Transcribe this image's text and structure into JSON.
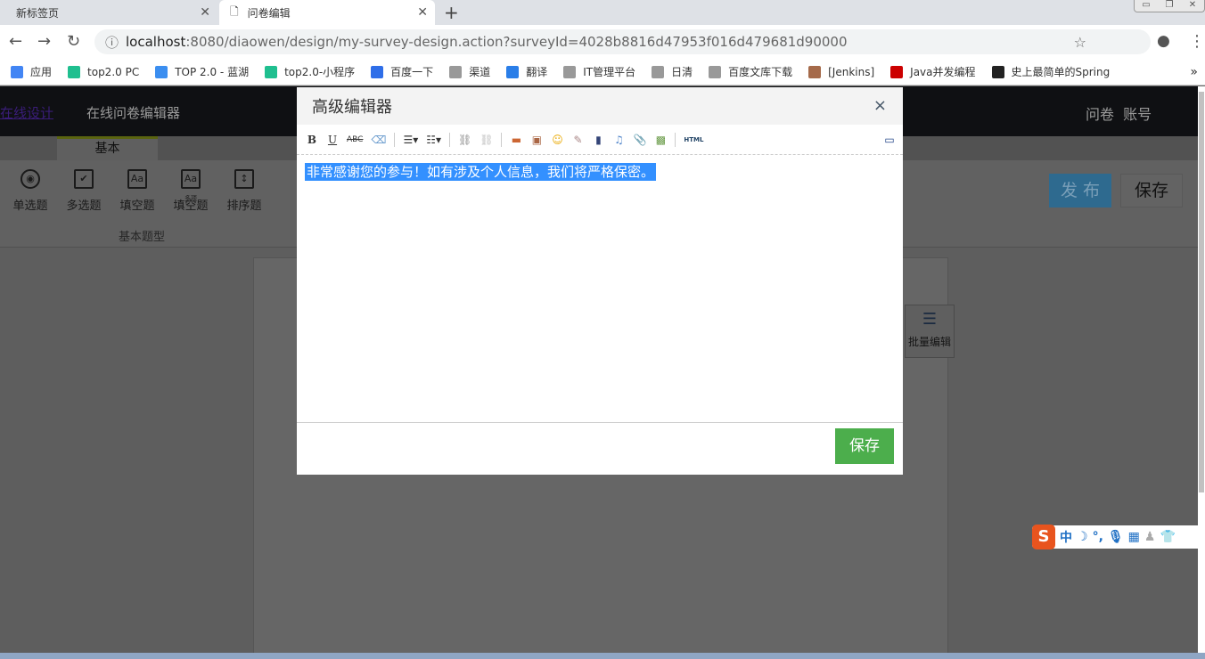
{
  "browser": {
    "tabs": [
      {
        "label": "新标签页"
      },
      {
        "label": "问卷编辑",
        "active": true
      }
    ],
    "url_host": "localhost",
    "url_rest": ":8080/diaowen/design/my-survey-design.action?surveyId=4028b8816d47953f016d479681d90000",
    "bookmarks": [
      {
        "label": "应用",
        "icon": "apps-icon",
        "color": "#4285f4"
      },
      {
        "label": "top2.0 PC",
        "icon": "play-icon",
        "color": "#1fbf8f"
      },
      {
        "label": "TOP 2.0 - 蓝湖",
        "icon": "lanhu-icon",
        "color": "#3b8ef0"
      },
      {
        "label": "top2.0-小程序",
        "icon": "play-icon",
        "color": "#1fbf8f"
      },
      {
        "label": "百度一下",
        "icon": "baidu-icon",
        "color": "#2f6ee8"
      },
      {
        "label": "渠道",
        "icon": "page-icon",
        "color": "#999999"
      },
      {
        "label": "翻译",
        "icon": "translate-icon",
        "color": "#2a7ee8"
      },
      {
        "label": "IT管理平台",
        "icon": "page-icon",
        "color": "#999999"
      },
      {
        "label": "日清",
        "icon": "page-icon",
        "color": "#999999"
      },
      {
        "label": "百度文库下载",
        "icon": "page-icon",
        "color": "#999999"
      },
      {
        "label": "[Jenkins]",
        "icon": "jenkins-icon",
        "color": "#a56a4a"
      },
      {
        "label": "Java并发编程",
        "icon": "c-icon",
        "color": "#cc0000"
      },
      {
        "label": "史上最简单的Spring",
        "icon": "github-icon",
        "color": "#222222"
      }
    ]
  },
  "app": {
    "logo": "在线设计",
    "title": "在线问卷编辑器",
    "nav": "问卷  账号",
    "tab_basic": "基本",
    "tools": [
      {
        "label": "单选题",
        "icon": "radio-icon"
      },
      {
        "label": "多选题",
        "icon": "checkbox-icon"
      },
      {
        "label": "填空题",
        "icon": "text-icon"
      },
      {
        "label": "填空题",
        "sub": "多项",
        "icon": "multi-text-icon"
      },
      {
        "label": "排序题",
        "icon": "sort-icon"
      }
    ],
    "group_label": "基本题型",
    "publish": "发 布",
    "save": "保存",
    "batch_edit": "批量编辑"
  },
  "modal": {
    "title": "高级编辑器",
    "close": "×",
    "content": "非常感谢您的参与！如有涉及个人信息，我们将严格保密。",
    "save": "保存",
    "toolbar": [
      "B",
      "U",
      "ABC",
      "eraser",
      "ul",
      "ol",
      "link",
      "unlink",
      "image",
      "multi-image",
      "emoji",
      "scrawl",
      "video",
      "music",
      "attachment",
      "map",
      "HTML",
      "preview"
    ]
  },
  "colors": {
    "save_green": "#4cae4c",
    "selection": "#3390ff",
    "publish_blue": "#4a9fd8"
  }
}
